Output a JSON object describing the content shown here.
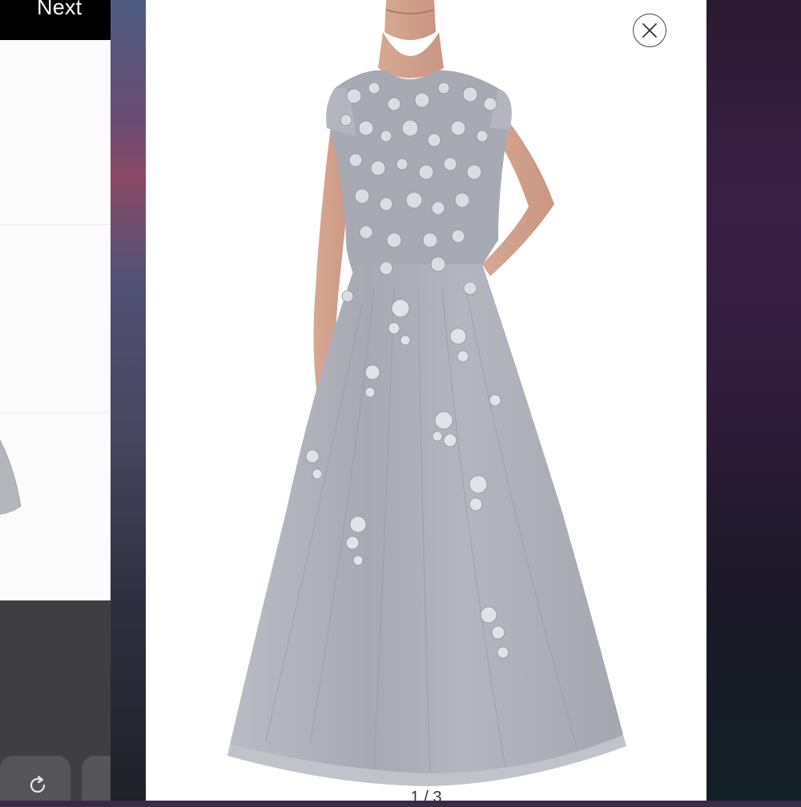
{
  "background_app": {
    "next_label": "Next"
  },
  "viewer": {
    "pager": "1 / 3",
    "close_icon": "close-icon",
    "image_subject": "dress-image"
  },
  "colors": {
    "dress_silver": "#a9acb5",
    "lace": "#dcdde3",
    "modal_bg": "#ffffff"
  }
}
